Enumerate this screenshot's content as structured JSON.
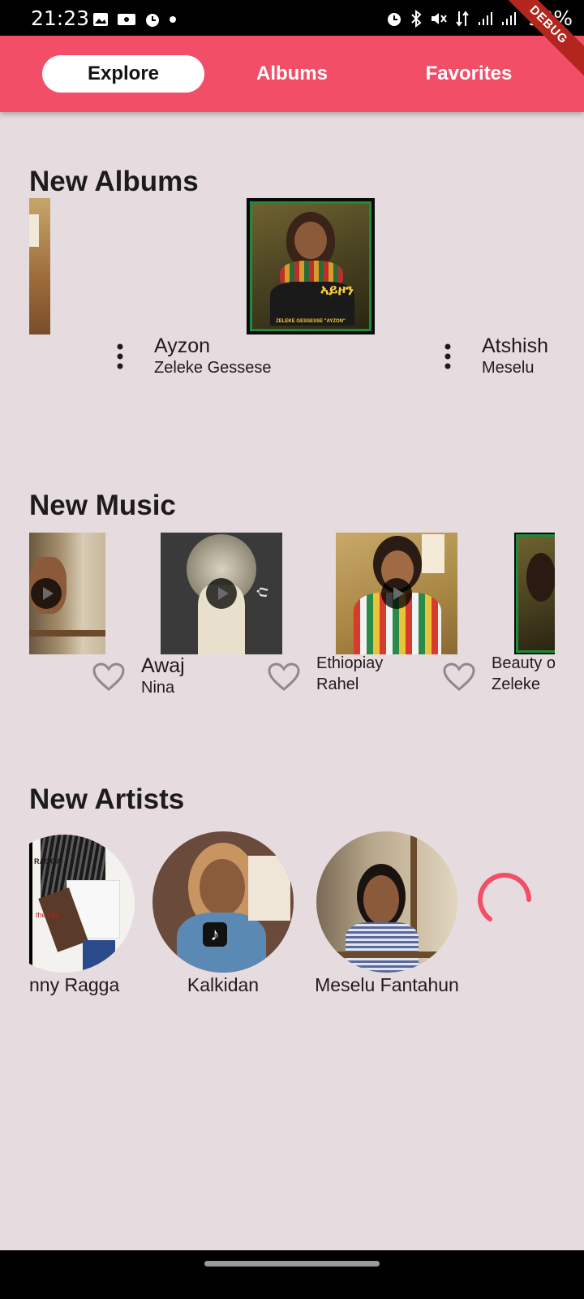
{
  "status": {
    "time": "21:23",
    "battery": "93%",
    "debug": "DEBUG"
  },
  "tabs": [
    {
      "label": "Explore",
      "active": true
    },
    {
      "label": "Albums",
      "active": false
    },
    {
      "label": "Favorites",
      "active": false
    }
  ],
  "sections": {
    "albums_title": "New Albums",
    "music_title": "New Music",
    "artists_title": "New Artists"
  },
  "albums": [
    {
      "title": "Ayzon",
      "artist": "Zeleke Gessese",
      "cover_text": "ZELEKE GESSESSE \"AYZON\""
    },
    {
      "title": "Atshish",
      "artist": "Meselu"
    }
  ],
  "music": [
    {
      "title": "Awaj",
      "artist": "Nina"
    },
    {
      "title": "Ethiopiay",
      "artist": "Rahel"
    },
    {
      "title": "Beauty o",
      "artist": "Zeleke"
    }
  ],
  "artists": [
    {
      "name": "nny Ragga"
    },
    {
      "name": "Kalkidan"
    },
    {
      "name": "Meselu Fantahun"
    }
  ],
  "colors": {
    "accent": "#f24e68",
    "background": "#e6dcdf",
    "text": "#1e1b1c"
  }
}
